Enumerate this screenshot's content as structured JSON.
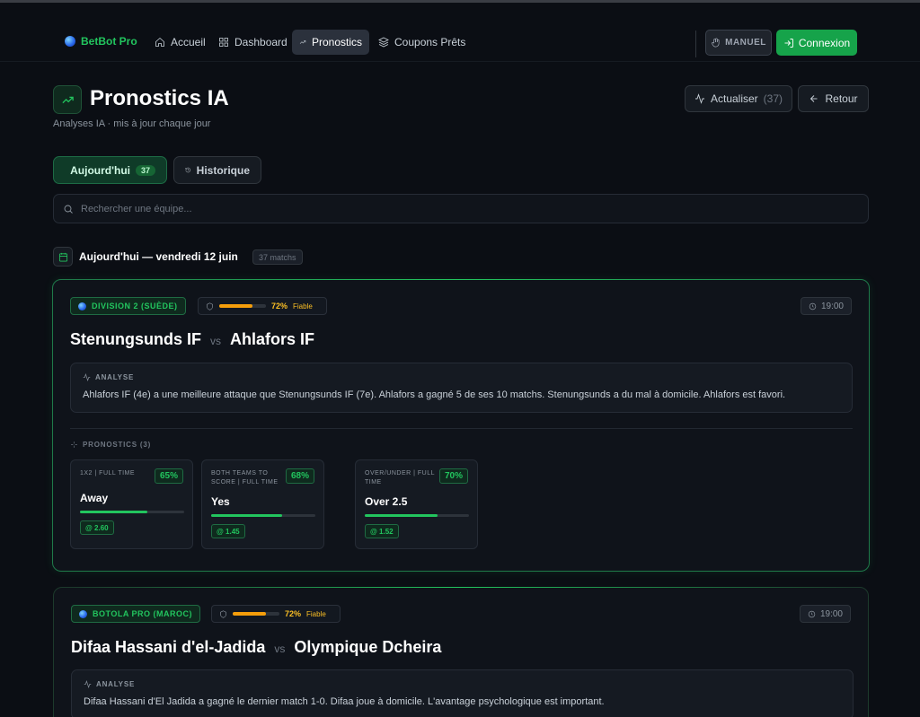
{
  "nav": {
    "brand": "BetBot Pro",
    "items": [
      {
        "label": "Accueil",
        "icon": "home-icon"
      },
      {
        "label": "Dashboard",
        "icon": "grid-icon"
      },
      {
        "label": "Pronostics",
        "icon": "trending-up-icon",
        "active": true
      },
      {
        "label": "Coupons Prêts",
        "icon": "layers-icon"
      }
    ],
    "manual_label": "MANUEL",
    "login_label": "Connexion"
  },
  "header": {
    "title": "Pronostics IA",
    "subtitle": "Analyses IA · mis à jour chaque jour",
    "refresh_label": "Actualiser",
    "refresh_count": "(37)",
    "back_label": "Retour"
  },
  "tabs": {
    "today_label": "Aujourd'hui",
    "today_count": "37",
    "history_label": "Historique"
  },
  "search": {
    "placeholder": "Rechercher une équipe..."
  },
  "day": {
    "title": "Aujourd'hui — vendredi 12 juin",
    "count": "37 matchs"
  },
  "matches": [
    {
      "league": "DIVISION 2 (SUÈDE)",
      "confidence_pct": "72%",
      "confidence_value": 72,
      "confidence_label": "Fiable",
      "time": "19:00",
      "home": "Stenungsunds IF",
      "vs": "vs",
      "away": "Ahlafors IF",
      "analysis_label": "ANALYSE",
      "analysis": "Ahlafors IF (4e) a une meilleure attaque que Stenungsunds IF (7e). Ahlafors a gagné 5 de ses 10 matchs. Stenungsunds a du mal à domicile. Ahlafors est favori.",
      "predictions_label": "PRONOSTICS (3)",
      "predictions": [
        {
          "market": "1X2 | FULL TIME",
          "pct": "65%",
          "pct_value": 65,
          "value": "Away",
          "odds": "@ 2.60"
        },
        {
          "market": "BOTH TEAMS TO SCORE | FULL TIME",
          "pct": "68%",
          "pct_value": 68,
          "value": "Yes",
          "odds": "@ 1.45"
        },
        {
          "market": "OVER/UNDER | FULL TIME",
          "pct": "70%",
          "pct_value": 70,
          "value": "Over 2.5",
          "odds": "@ 1.52"
        }
      ]
    },
    {
      "league": "BOTOLA PRO (MAROC)",
      "confidence_pct": "72%",
      "confidence_value": 72,
      "confidence_label": "Fiable",
      "time": "19:00",
      "home": "Difaa Hassani d'el-Jadida",
      "vs": "vs",
      "away": "Olympique Dcheira",
      "analysis_label": "ANALYSE",
      "analysis": "Difaa Hassani d'El Jadida a gagné le dernier match 1-0. Difaa joue à domicile. L'avantage psychologique est important."
    }
  ],
  "colors": {
    "accent": "#22c55e",
    "warning": "#f59e0b",
    "background": "#0b0e14"
  }
}
